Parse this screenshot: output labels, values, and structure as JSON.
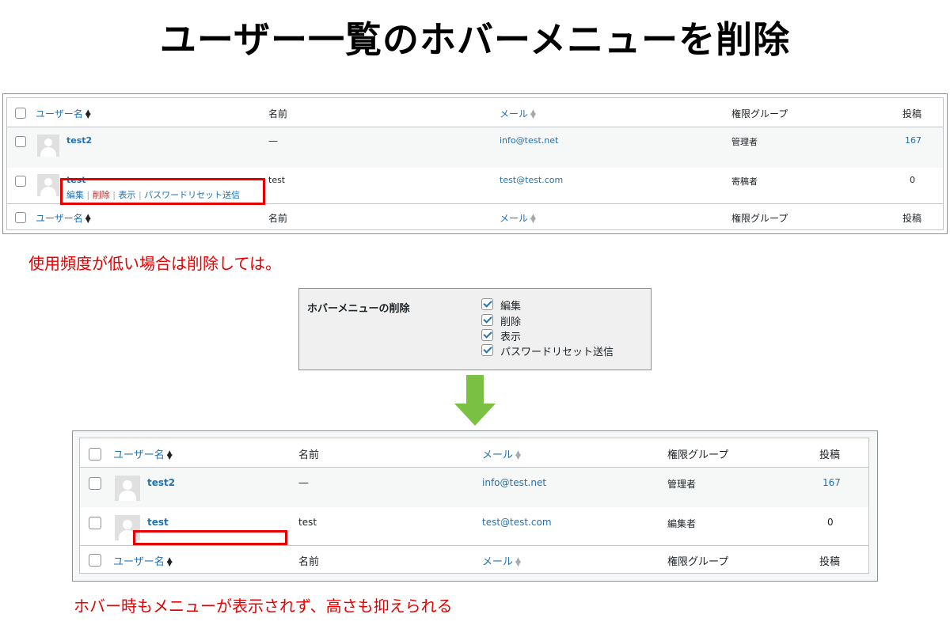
{
  "page_title": "ユーザー一覧のホバーメニューを削除",
  "table_headers": {
    "username": "ユーザー名",
    "name": "名前",
    "email": "メール",
    "role": "権限グループ",
    "posts": "投稿"
  },
  "before_table": {
    "rows": [
      {
        "username": "test2",
        "name": "—",
        "email": "info@test.net",
        "role": "管理者",
        "posts": "167"
      },
      {
        "username": "test",
        "name": "test",
        "email": "test@test.com",
        "role": "寄稿者",
        "posts": "0"
      }
    ],
    "row_actions": {
      "edit": "編集",
      "delete": "削除",
      "view": "表示",
      "reset_password": "パスワードリセット送信",
      "separator": "|"
    }
  },
  "note_top": "使用頻度が低い場合は削除しては。",
  "settings": {
    "label": "ホバーメニューの削除",
    "options": [
      {
        "label": "編集",
        "checked": true
      },
      {
        "label": "削除",
        "checked": true
      },
      {
        "label": "表示",
        "checked": true
      },
      {
        "label": "パスワードリセット送信",
        "checked": true
      }
    ]
  },
  "after_table": {
    "rows": [
      {
        "username": "test2",
        "name": "—",
        "email": "info@test.net",
        "role": "管理者",
        "posts": "167"
      },
      {
        "username": "test",
        "name": "test",
        "email": "test@test.com",
        "role": "編集者",
        "posts": "0"
      }
    ]
  },
  "note_bottom": "ホバー時もメニューが表示されず、高さも抑えられる",
  "colors": {
    "accent_link": "#2271b1",
    "annotation_red": "#e60000",
    "arrow_green": "#7ac143",
    "delete_link": "#b32d2e"
  }
}
